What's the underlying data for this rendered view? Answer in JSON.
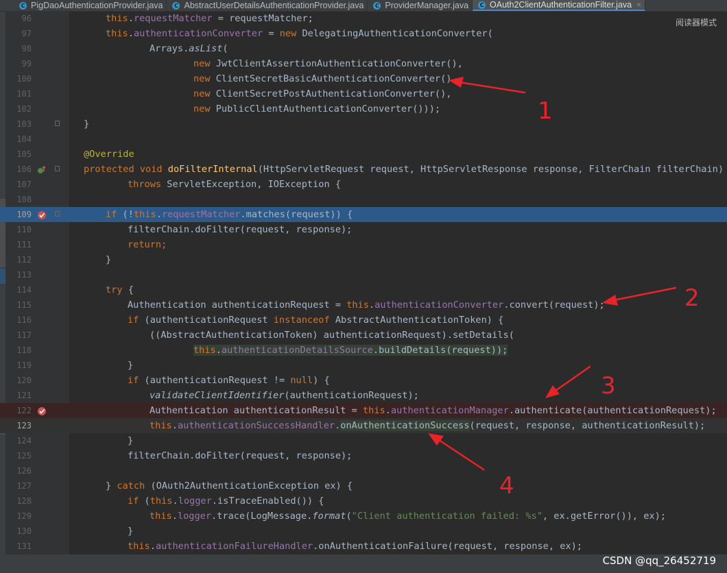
{
  "tabs": [
    {
      "label": "PigDaoAuthenticationProvider.java",
      "icon": "C"
    },
    {
      "label": "AbstractUserDetailsAuthenticationProvider.java",
      "icon": "C"
    },
    {
      "label": "ProviderManager.java",
      "icon": "C"
    },
    {
      "label": "OAuth2ClientAuthenticationFilter.java",
      "icon": "C",
      "active": true,
      "close": "×"
    }
  ],
  "reader_mode": "阅读器模式",
  "annotations": [
    "1",
    "2",
    "3",
    "4"
  ],
  "watermark": "CSDN @qq_26452719",
  "colors": {
    "accent_red": "#e8242a",
    "selection": "#2d5989",
    "keyword": "#cc7832",
    "field": "#9876aa"
  },
  "lines": [
    {
      "n": "96"
    },
    {
      "n": "97"
    },
    {
      "n": "98"
    },
    {
      "n": "99"
    },
    {
      "n": "100"
    },
    {
      "n": "101"
    },
    {
      "n": "102"
    },
    {
      "n": "103"
    },
    {
      "n": "104"
    },
    {
      "n": "105"
    },
    {
      "n": "106"
    },
    {
      "n": "107"
    },
    {
      "n": "108"
    },
    {
      "n": "109"
    },
    {
      "n": "110"
    },
    {
      "n": "111"
    },
    {
      "n": "112"
    },
    {
      "n": "113"
    },
    {
      "n": "114"
    },
    {
      "n": "115"
    },
    {
      "n": "116"
    },
    {
      "n": "117"
    },
    {
      "n": "118"
    },
    {
      "n": "119"
    },
    {
      "n": "120"
    },
    {
      "n": "121"
    },
    {
      "n": "122"
    },
    {
      "n": "123"
    },
    {
      "n": "124"
    },
    {
      "n": "125"
    },
    {
      "n": "126"
    },
    {
      "n": "127"
    },
    {
      "n": "128"
    },
    {
      "n": "129"
    },
    {
      "n": "130"
    },
    {
      "n": "131"
    }
  ],
  "code": {
    "l96": {
      "t1": "this",
      "t2": ".",
      "t3": "requestMatcher",
      "t4": " = requestMatcher;"
    },
    "l97": {
      "t1": "this",
      "t2": ".",
      "t3": "authenticationConverter",
      "t4": " = ",
      "t5": "new",
      "t6": " DelegatingAuthenticationConverter("
    },
    "l98": {
      "t1": "Arrays.",
      "t2": "asList",
      "t3": "("
    },
    "l99": {
      "t1": "new",
      "t2": " JwtClientAssertionAuthenticationConverter(),"
    },
    "l100": {
      "t1": "new",
      "t2": " ClientSecretBasicAuthenticationConverter(),"
    },
    "l101": {
      "t1": "new",
      "t2": " ClientSecretPostAuthenticationConverter(),"
    },
    "l102": {
      "t1": "new",
      "t2": " PublicClientAuthenticationConverter()));"
    },
    "l103": {
      "t1": "}"
    },
    "l105": {
      "t1": "@Override"
    },
    "l106": {
      "t1": "protected void ",
      "t2": "doFilterInternal",
      "t3": "(HttpServletRequest request, HttpServletResponse response, FilterChain filterChain)"
    },
    "l107": {
      "t1": "throws",
      "t2": " ServletException, IOException {"
    },
    "l109": {
      "t1": "if",
      "t2": " (!",
      "t3": "this",
      "t4": ".",
      "t5": "requestMatcher",
      "t6": ".matches(request)) {"
    },
    "l110": {
      "t1": "filterChain.doFilter(request, response);"
    },
    "l111": {
      "t1": "return;"
    },
    "l112": {
      "t1": "}"
    },
    "l114": {
      "t1": "try",
      "t2": " {"
    },
    "l115": {
      "t1": "Authentication authenticationRequest = ",
      "t2": "this",
      "t3": ".",
      "t4": "authenticationConverter",
      "t5": ".convert(request);"
    },
    "l116": {
      "t1": "if",
      "t2": " (authenticationRequest ",
      "t3": "instanceof",
      "t4": " AbstractAuthenticationToken) {"
    },
    "l117": {
      "t1": "((AbstractAuthenticationToken) authenticationRequest).setDetails("
    },
    "l118": {
      "t1": "this",
      "t2": ".",
      "t3": "authenticationDetailsSource",
      "t4": ".buildDetails(request));"
    },
    "l119": {
      "t1": "}"
    },
    "l120": {
      "t1": "if",
      "t2": " (authenticationRequest != ",
      "t3": "null",
      "t4": ") {"
    },
    "l121": {
      "t1": "validateClientIdentifier",
      "t2": "(authenticationRequest);"
    },
    "l122": {
      "t1": "Authentication authenticationResult = ",
      "t2": "this",
      "t3": ".",
      "t4": "authenticationManager",
      "t5": ".authenticate(authenticationRequest);"
    },
    "l123": {
      "t1": "this",
      "t2": ".",
      "t3": "authenticationSuccessHandler",
      "t4": ".",
      "t5": "onAuthenticationSuccess",
      "t6": "(request, response, authenticationResult);"
    },
    "l124": {
      "t1": "}"
    },
    "l125": {
      "t1": "filterChain.doFilter(request, response);"
    },
    "l127": {
      "t1": "} ",
      "t2": "catch",
      "t3": " (OAuth2AuthenticationException ex) {"
    },
    "l128": {
      "t1": "if",
      "t2": " (",
      "t3": "this",
      "t4": ".",
      "t5": "logger",
      "t6": ".isTraceEnabled()) {"
    },
    "l129": {
      "t1": "this",
      "t2": ".",
      "t3": "logger",
      "t4": ".trace(LogMessage.",
      "t5": "format",
      "t6": "(",
      "t7": "\"Client authentication failed: %s\"",
      "t8": ", ex.getError()), ex);"
    },
    "l130": {
      "t1": "}"
    },
    "l131": {
      "t1": "this",
      "t2": ".",
      "t3": "authenticationFailureHandler",
      "t4": ".onAuthenticationFailure(request, response, ex);"
    }
  }
}
